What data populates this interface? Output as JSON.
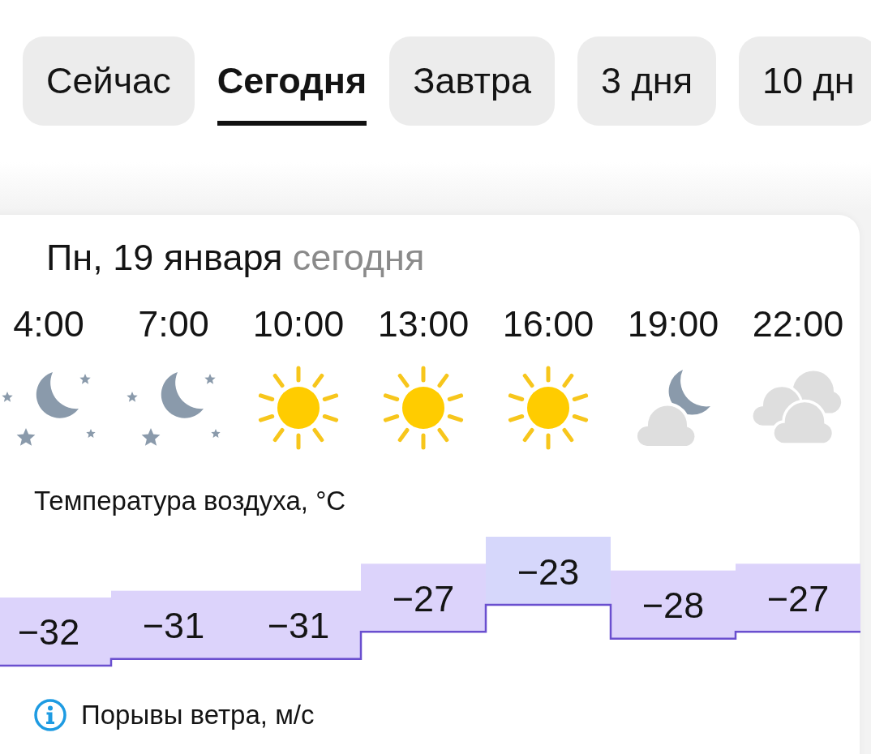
{
  "tabs": [
    {
      "label": "Сейчас",
      "selected": false
    },
    {
      "label": "Сегодня",
      "selected": true
    },
    {
      "label": "Завтра",
      "selected": false
    },
    {
      "label": "3 дня",
      "selected": false
    },
    {
      "label": "10 дн",
      "selected": false
    }
  ],
  "day": {
    "date": "Пн, 19 января",
    "relative": "сегодня"
  },
  "hours": [
    {
      "time": "4:00",
      "kind": "night-clear"
    },
    {
      "time": "7:00",
      "kind": "night-clear"
    },
    {
      "time": "10:00",
      "kind": "sunny"
    },
    {
      "time": "13:00",
      "kind": "sunny"
    },
    {
      "time": "16:00",
      "kind": "sunny"
    },
    {
      "time": "19:00",
      "kind": "night-cloudy"
    },
    {
      "time": "22:00",
      "kind": "cloudy"
    }
  ],
  "temperature": {
    "title": "Температура воздуха, °C",
    "readings": [
      "−32",
      "−31",
      "−31",
      "−27",
      "−23",
      "−28",
      "−27"
    ]
  },
  "wind": {
    "title": "Порывы ветра, м/с"
  }
}
